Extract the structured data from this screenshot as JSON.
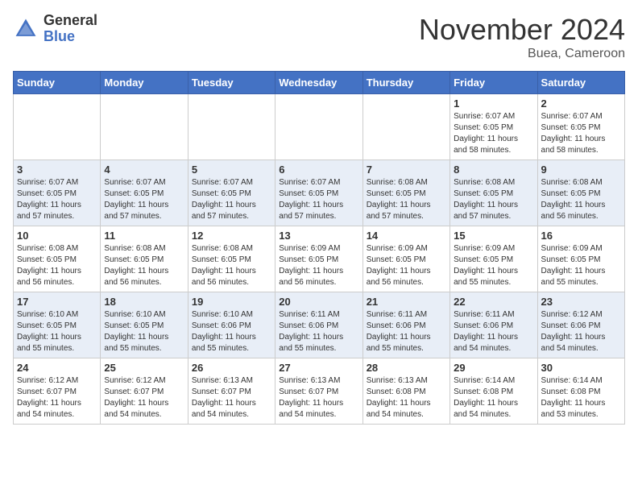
{
  "header": {
    "logo_general": "General",
    "logo_blue": "Blue",
    "month_year": "November 2024",
    "location": "Buea, Cameroon"
  },
  "weekdays": [
    "Sunday",
    "Monday",
    "Tuesday",
    "Wednesday",
    "Thursday",
    "Friday",
    "Saturday"
  ],
  "weeks": [
    [
      {
        "day": "",
        "info": ""
      },
      {
        "day": "",
        "info": ""
      },
      {
        "day": "",
        "info": ""
      },
      {
        "day": "",
        "info": ""
      },
      {
        "day": "",
        "info": ""
      },
      {
        "day": "1",
        "info": "Sunrise: 6:07 AM\nSunset: 6:05 PM\nDaylight: 11 hours\nand 58 minutes."
      },
      {
        "day": "2",
        "info": "Sunrise: 6:07 AM\nSunset: 6:05 PM\nDaylight: 11 hours\nand 58 minutes."
      }
    ],
    [
      {
        "day": "3",
        "info": "Sunrise: 6:07 AM\nSunset: 6:05 PM\nDaylight: 11 hours\nand 57 minutes."
      },
      {
        "day": "4",
        "info": "Sunrise: 6:07 AM\nSunset: 6:05 PM\nDaylight: 11 hours\nand 57 minutes."
      },
      {
        "day": "5",
        "info": "Sunrise: 6:07 AM\nSunset: 6:05 PM\nDaylight: 11 hours\nand 57 minutes."
      },
      {
        "day": "6",
        "info": "Sunrise: 6:07 AM\nSunset: 6:05 PM\nDaylight: 11 hours\nand 57 minutes."
      },
      {
        "day": "7",
        "info": "Sunrise: 6:08 AM\nSunset: 6:05 PM\nDaylight: 11 hours\nand 57 minutes."
      },
      {
        "day": "8",
        "info": "Sunrise: 6:08 AM\nSunset: 6:05 PM\nDaylight: 11 hours\nand 57 minutes."
      },
      {
        "day": "9",
        "info": "Sunrise: 6:08 AM\nSunset: 6:05 PM\nDaylight: 11 hours\nand 56 minutes."
      }
    ],
    [
      {
        "day": "10",
        "info": "Sunrise: 6:08 AM\nSunset: 6:05 PM\nDaylight: 11 hours\nand 56 minutes."
      },
      {
        "day": "11",
        "info": "Sunrise: 6:08 AM\nSunset: 6:05 PM\nDaylight: 11 hours\nand 56 minutes."
      },
      {
        "day": "12",
        "info": "Sunrise: 6:08 AM\nSunset: 6:05 PM\nDaylight: 11 hours\nand 56 minutes."
      },
      {
        "day": "13",
        "info": "Sunrise: 6:09 AM\nSunset: 6:05 PM\nDaylight: 11 hours\nand 56 minutes."
      },
      {
        "day": "14",
        "info": "Sunrise: 6:09 AM\nSunset: 6:05 PM\nDaylight: 11 hours\nand 56 minutes."
      },
      {
        "day": "15",
        "info": "Sunrise: 6:09 AM\nSunset: 6:05 PM\nDaylight: 11 hours\nand 55 minutes."
      },
      {
        "day": "16",
        "info": "Sunrise: 6:09 AM\nSunset: 6:05 PM\nDaylight: 11 hours\nand 55 minutes."
      }
    ],
    [
      {
        "day": "17",
        "info": "Sunrise: 6:10 AM\nSunset: 6:05 PM\nDaylight: 11 hours\nand 55 minutes."
      },
      {
        "day": "18",
        "info": "Sunrise: 6:10 AM\nSunset: 6:05 PM\nDaylight: 11 hours\nand 55 minutes."
      },
      {
        "day": "19",
        "info": "Sunrise: 6:10 AM\nSunset: 6:06 PM\nDaylight: 11 hours\nand 55 minutes."
      },
      {
        "day": "20",
        "info": "Sunrise: 6:11 AM\nSunset: 6:06 PM\nDaylight: 11 hours\nand 55 minutes."
      },
      {
        "day": "21",
        "info": "Sunrise: 6:11 AM\nSunset: 6:06 PM\nDaylight: 11 hours\nand 55 minutes."
      },
      {
        "day": "22",
        "info": "Sunrise: 6:11 AM\nSunset: 6:06 PM\nDaylight: 11 hours\nand 54 minutes."
      },
      {
        "day": "23",
        "info": "Sunrise: 6:12 AM\nSunset: 6:06 PM\nDaylight: 11 hours\nand 54 minutes."
      }
    ],
    [
      {
        "day": "24",
        "info": "Sunrise: 6:12 AM\nSunset: 6:07 PM\nDaylight: 11 hours\nand 54 minutes."
      },
      {
        "day": "25",
        "info": "Sunrise: 6:12 AM\nSunset: 6:07 PM\nDaylight: 11 hours\nand 54 minutes."
      },
      {
        "day": "26",
        "info": "Sunrise: 6:13 AM\nSunset: 6:07 PM\nDaylight: 11 hours\nand 54 minutes."
      },
      {
        "day": "27",
        "info": "Sunrise: 6:13 AM\nSunset: 6:07 PM\nDaylight: 11 hours\nand 54 minutes."
      },
      {
        "day": "28",
        "info": "Sunrise: 6:13 AM\nSunset: 6:08 PM\nDaylight: 11 hours\nand 54 minutes."
      },
      {
        "day": "29",
        "info": "Sunrise: 6:14 AM\nSunset: 6:08 PM\nDaylight: 11 hours\nand 54 minutes."
      },
      {
        "day": "30",
        "info": "Sunrise: 6:14 AM\nSunset: 6:08 PM\nDaylight: 11 hours\nand 53 minutes."
      }
    ]
  ]
}
